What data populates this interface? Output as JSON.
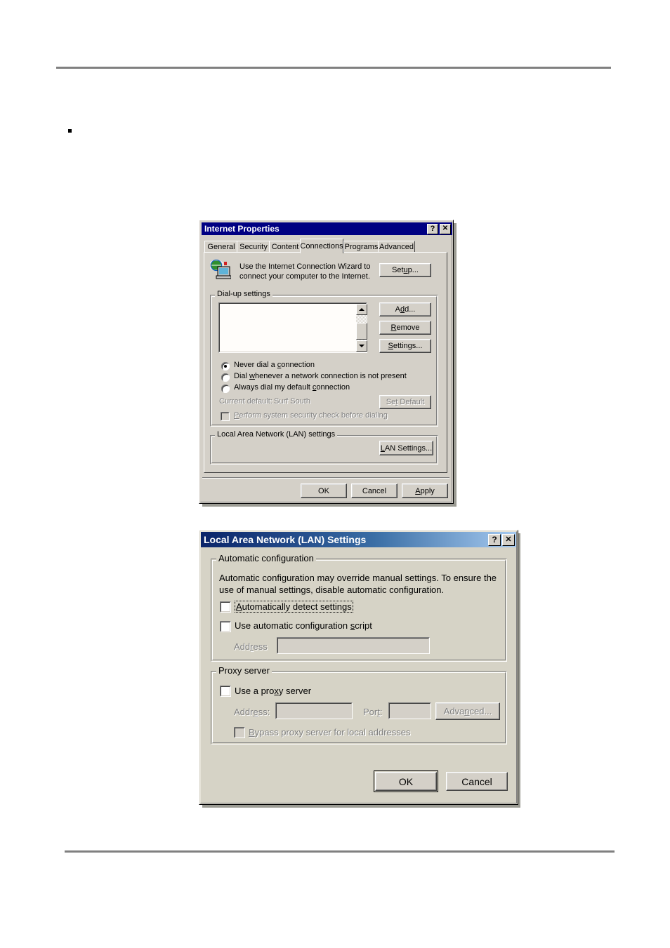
{
  "page": {
    "bullet_text": ""
  },
  "internet_properties": {
    "title": "Internet Properties",
    "titlebar_buttons": [
      {
        "name": "help-button",
        "glyph": "?"
      },
      {
        "name": "close-button",
        "glyph": "✕"
      }
    ],
    "tabs": [
      {
        "label": "General",
        "active": false
      },
      {
        "label": "Security",
        "active": false
      },
      {
        "label": "Content",
        "active": false
      },
      {
        "label": "Connections",
        "active": true
      },
      {
        "label": "Programs",
        "active": false
      },
      {
        "label": "Advanced",
        "active": false
      }
    ],
    "wizard": {
      "line1": "Use the Internet Connection Wizard to",
      "line2": "connect your computer to the Internet.",
      "setup_button": {
        "pre": "Set",
        "accel": "u",
        "post": "p..."
      }
    },
    "dialup": {
      "group_label": "Dial-up settings",
      "list_items": [],
      "buttons": [
        {
          "name": "add-button",
          "pre": "A",
          "accel": "d",
          "post": "d..."
        },
        {
          "name": "remove-button",
          "pre": "",
          "accel": "R",
          "post": "emove"
        },
        {
          "name": "settings-button",
          "pre": "",
          "accel": "S",
          "post": "ettings..."
        }
      ],
      "radios": [
        {
          "name": "never-dial-radio",
          "selected": true,
          "pre": "Never dial a ",
          "accel": "c",
          "post": "onnection"
        },
        {
          "name": "dial-whenever-radio",
          "selected": false,
          "pre": "Dial ",
          "accel": "w",
          "post": "henever a network connection is not present"
        },
        {
          "name": "always-dial-radio",
          "selected": false,
          "pre": "Always dial my default ",
          "accel": "c",
          "post": "onnection"
        }
      ],
      "current_default_label": "Current default:",
      "current_default_value": "Surf South",
      "set_default_button": {
        "pre": "Se",
        "accel": "t",
        "post": " Default"
      },
      "security_check": {
        "pre": "",
        "accel": "P",
        "post": "erform system security check before dialing",
        "checked": false
      }
    },
    "lan_group": {
      "group_label": "Local Area Network (LAN) settings",
      "lan_settings_button": {
        "pre": "",
        "accel": "L",
        "post": "AN Settings..."
      }
    },
    "footer_buttons": [
      {
        "name": "ok-button",
        "pre": "OK",
        "accel": "",
        "post": ""
      },
      {
        "name": "cancel-button",
        "pre": "Cancel",
        "accel": "",
        "post": ""
      },
      {
        "name": "apply-button",
        "pre": "",
        "accel": "A",
        "post": "pply"
      }
    ]
  },
  "lan_settings": {
    "title": "Local Area Network (LAN) Settings",
    "titlebar_buttons": [
      {
        "name": "help-button",
        "glyph": "?"
      },
      {
        "name": "close-button",
        "glyph": "✕"
      }
    ],
    "automatic_configuration": {
      "group_label": "Automatic configuration",
      "description_line1": "Automatic configuration may override manual settings.  To ensure the",
      "description_line2": "use of manual settings, disable automatic configuration.",
      "auto_detect": {
        "pre": "",
        "accel": "A",
        "post": "utomatically detect settings",
        "checked": false,
        "focused": true
      },
      "auto_script": {
        "pre": "Use automatic configuration ",
        "accel": "s",
        "post": "cript",
        "checked": false
      },
      "address_label": {
        "pre": "Add",
        "accel": "r",
        "post": "ess"
      },
      "address_value": ""
    },
    "proxy_server": {
      "group_label": "Proxy server",
      "use_proxy": {
        "pre": "Use a pro",
        "accel": "x",
        "post": "y server",
        "checked": false
      },
      "address_label": {
        "pre": "Addr",
        "accel": "e",
        "post": "ss:"
      },
      "address_value": "",
      "port_label": {
        "pre": "Por",
        "accel": "t",
        "post": ":"
      },
      "port_value": "",
      "advanced_button": {
        "pre": "Adva",
        "accel": "n",
        "post": "ced..."
      },
      "bypass": {
        "pre": "",
        "accel": "B",
        "post": "ypass proxy server for local addresses",
        "checked": false
      }
    },
    "footer_buttons": [
      {
        "name": "ok-button",
        "label": "OK",
        "default": true
      },
      {
        "name": "cancel-button",
        "label": "Cancel",
        "default": false
      }
    ]
  }
}
